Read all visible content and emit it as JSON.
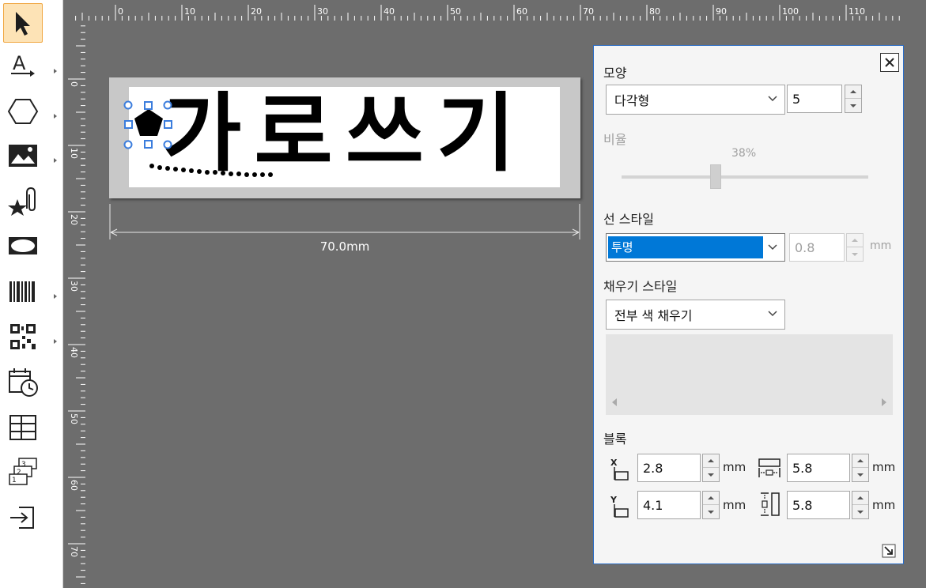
{
  "toolbar": {
    "tools": [
      "select-tool",
      "text-tool",
      "shape-tool",
      "image-tool",
      "clipart-tool",
      "frame-tool",
      "barcode-tool",
      "qrcode-tool",
      "datetime-tool",
      "table-tool",
      "database-tool",
      "insert-tool"
    ]
  },
  "ruler": {
    "top_labels": [
      "0",
      "10",
      "20",
      "30",
      "40",
      "50",
      "60",
      "70",
      "80",
      "90",
      "100",
      "110"
    ],
    "left_labels": [
      "0",
      "10",
      "20",
      "30",
      "40",
      "50",
      "60",
      "70"
    ]
  },
  "label": {
    "text": "가로쓰기",
    "width_dimension": "70.0mm"
  },
  "panel": {
    "shape": {
      "title": "모양",
      "type_value": "다각형",
      "sides_value": "5"
    },
    "ratio": {
      "title": "비율",
      "value": "38%",
      "fraction": 0.38
    },
    "line_style": {
      "title": "선 스타일",
      "value": "투명",
      "width_value": "0.8",
      "unit": "mm"
    },
    "fill_style": {
      "title": "채우기 스타일",
      "value": "전부 색 채우기"
    },
    "block": {
      "title": "블록",
      "x_value": "2.8",
      "y_value": "4.1",
      "width_value": "5.8",
      "height_value": "5.8",
      "unit": "mm"
    }
  },
  "colors": {
    "accent": "#0078d7",
    "workspace": "#6d6d6d",
    "selection": "#3b7ddd"
  }
}
